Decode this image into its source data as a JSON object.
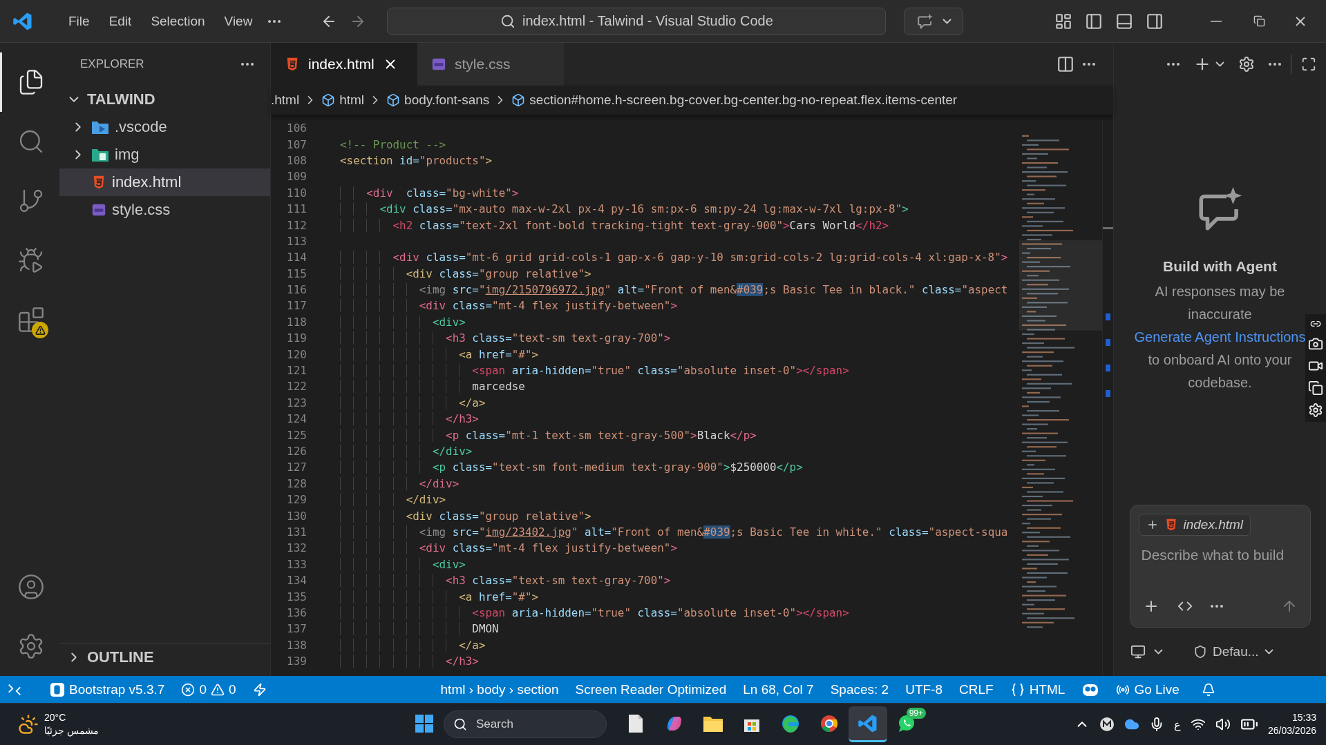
{
  "title_bar": {
    "menu": [
      "File",
      "Edit",
      "Selection",
      "View"
    ],
    "command_center": "index.html - Talwind - Visual Studio Code"
  },
  "activity_bar": [
    {
      "kind": "explorer",
      "selected": true
    },
    {
      "kind": "search",
      "selected": false
    },
    {
      "kind": "source-control",
      "selected": false
    },
    {
      "kind": "run",
      "selected": false
    },
    {
      "kind": "extensions",
      "selected": false,
      "warning": true
    },
    {
      "kind": "account",
      "selected": false
    },
    {
      "kind": "settings",
      "selected": false
    }
  ],
  "explorer": {
    "title": "EXPLORER",
    "root": {
      "label": "TALWIND",
      "expanded": true,
      "children": [
        {
          "label": ".vscode",
          "kind": "folder",
          "expanded": false,
          "selected": false
        },
        {
          "label": "img",
          "kind": "image-folder",
          "expanded": false,
          "selected": false
        },
        {
          "label": "index.html",
          "kind": "html",
          "selected": true
        },
        {
          "label": "style.css",
          "kind": "css",
          "selected": false
        }
      ]
    },
    "outline": {
      "label": "OUTLINE",
      "expanded": false
    }
  },
  "tabs": [
    {
      "label": "index.html",
      "kind": "html",
      "selected": true
    },
    {
      "label": "style.css",
      "kind": "css",
      "selected": false
    }
  ],
  "breadcrumbs": [
    {
      "text": ".html",
      "kind": "file"
    },
    {
      "text": "html",
      "kind": "element"
    },
    {
      "text": "body.font-sans",
      "kind": "element"
    },
    {
      "text": "section#home.h-screen.bg-cover.bg-center.bg-no-repeat.flex.items-center",
      "kind": "element"
    }
  ],
  "editor": {
    "lines": [
      {
        "number": "106"
      },
      {
        "number": "107",
        "tokens": [
          {
            "kind": "comment",
            "text": "<!-- Product -->"
          }
        ]
      },
      {
        "number": "108",
        "tokens": [
          {
            "kind": "tag",
            "text": "<section",
            "color": "#d7ba7d"
          },
          {
            "kind": "attr",
            "text": " id="
          },
          {
            "kind": "string",
            "text": "\"products\""
          },
          {
            "kind": "tag",
            "text": ">",
            "color": "#d7ba7d"
          }
        ]
      },
      {
        "number": "109"
      },
      {
        "number": "110",
        "tokens": [
          {
            "kind": "tag",
            "text": "    <div",
            "color": "#e06c8a"
          },
          {
            "kind": "attr",
            "text": "  class="
          },
          {
            "kind": "string",
            "text": "\"bg-white\""
          },
          {
            "kind": "tag",
            "text": ">",
            "color": "#e06c8a"
          }
        ]
      },
      {
        "number": "111",
        "tokens": [
          {
            "kind": "tag",
            "text": "      <div",
            "color": "#4ec9a0"
          },
          {
            "kind": "attr",
            "text": " class="
          },
          {
            "kind": "string",
            "text": "\"mx-auto max-w-2xl px-4 py-16 sm:px-6 sm:py-24 lg:max-w-7xl lg:px-8\""
          },
          {
            "kind": "tag",
            "text": ">",
            "color": "#4ec9a0"
          }
        ]
      },
      {
        "number": "112",
        "tokens": [
          {
            "kind": "tag",
            "text": "        <h2",
            "color": "#d64a6b"
          },
          {
            "kind": "attr",
            "text": " class="
          },
          {
            "kind": "string",
            "text": "\"text-2xl font-bold tracking-tight text-gray-900\""
          },
          {
            "kind": "tag",
            "text": ">",
            "color": "#d64a6b"
          },
          {
            "kind": "text",
            "text": "Cars World"
          },
          {
            "kind": "tag",
            "text": "</h2>",
            "color": "#d64a6b"
          }
        ]
      },
      {
        "number": "113"
      },
      {
        "number": "114",
        "tokens": [
          {
            "kind": "tag",
            "text": "        <div",
            "color": "#e06c8a"
          },
          {
            "kind": "attr",
            "text": " class="
          },
          {
            "kind": "string",
            "text": "\"mt-6 grid grid-cols-1 gap-x-6 gap-y-10 sm:grid-cols-2 lg:grid-cols-4 xl:gap-x-8\""
          },
          {
            "kind": "tag",
            "text": ">",
            "color": "#e06c8a"
          }
        ]
      },
      {
        "number": "115",
        "tokens": [
          {
            "kind": "tag",
            "text": "          <div",
            "color": "#d7ba7d"
          },
          {
            "kind": "attr",
            "text": " class="
          },
          {
            "kind": "string",
            "text": "\"group relative\""
          },
          {
            "kind": "tag",
            "text": ">",
            "color": "#d7ba7d"
          }
        ]
      },
      {
        "number": "116",
        "tokens": [
          {
            "kind": "tag",
            "text": "            <img",
            "color": "#8c8c8c"
          },
          {
            "kind": "attr",
            "text": " src="
          },
          {
            "kind": "string",
            "text": "\""
          },
          {
            "kind": "link",
            "text": "img/2150796972.jpg"
          },
          {
            "kind": "string",
            "text": "\""
          },
          {
            "kind": "attr",
            "text": " alt="
          },
          {
            "kind": "string",
            "text": "\"Front of men&"
          },
          {
            "kind": "highlight",
            "text": "#039"
          },
          {
            "kind": "string",
            "text": ";s Basic Tee in black.\""
          },
          {
            "kind": "attr",
            "text": " class="
          },
          {
            "kind": "string",
            "text": "\"aspect"
          }
        ]
      },
      {
        "number": "117",
        "tokens": [
          {
            "kind": "tag",
            "text": "            <div",
            "color": "#e06c8a"
          },
          {
            "kind": "attr",
            "text": " class="
          },
          {
            "kind": "string",
            "text": "\"mt-4 flex justify-between\""
          },
          {
            "kind": "tag",
            "text": ">",
            "color": "#e06c8a"
          }
        ]
      },
      {
        "number": "118",
        "tokens": [
          {
            "kind": "tag",
            "text": "              <div>",
            "color": "#4ec9a0"
          }
        ]
      },
      {
        "number": "119",
        "tokens": [
          {
            "kind": "tag",
            "text": "                <h3",
            "color": "#e06c8a"
          },
          {
            "kind": "attr",
            "text": " class="
          },
          {
            "kind": "string",
            "text": "\"text-sm text-gray-700\""
          },
          {
            "kind": "tag",
            "text": ">",
            "color": "#e06c8a"
          }
        ]
      },
      {
        "number": "120",
        "tokens": [
          {
            "kind": "tag",
            "text": "                  <a",
            "color": "#d7ba7d"
          },
          {
            "kind": "attr",
            "text": " href="
          },
          {
            "kind": "string",
            "text": "\"#\""
          },
          {
            "kind": "tag",
            "text": ">",
            "color": "#d7ba7d"
          }
        ]
      },
      {
        "number": "121",
        "tokens": [
          {
            "kind": "tag",
            "text": "                    <span",
            "color": "#d64a6b"
          },
          {
            "kind": "attr",
            "text": " aria-hidden="
          },
          {
            "kind": "string",
            "text": "\"true\""
          },
          {
            "kind": "attr",
            "text": " class="
          },
          {
            "kind": "string",
            "text": "\"absolute inset-0\""
          },
          {
            "kind": "tag",
            "text": "></span>",
            "color": "#d64a6b"
          }
        ]
      },
      {
        "number": "122",
        "tokens": [
          {
            "kind": "text",
            "text": "                    marcedse"
          }
        ]
      },
      {
        "number": "123",
        "tokens": [
          {
            "kind": "tag",
            "text": "                  </a>",
            "color": "#d7ba7d"
          }
        ]
      },
      {
        "number": "124",
        "tokens": [
          {
            "kind": "tag",
            "text": "                </h3>",
            "color": "#e06c8a"
          }
        ]
      },
      {
        "number": "125",
        "tokens": [
          {
            "kind": "tag",
            "text": "                <p",
            "color": "#e06c8a"
          },
          {
            "kind": "attr",
            "text": " class="
          },
          {
            "kind": "string",
            "text": "\"mt-1 text-sm text-gray-500\""
          },
          {
            "kind": "tag",
            "text": ">",
            "color": "#e06c8a"
          },
          {
            "kind": "text",
            "text": "Black"
          },
          {
            "kind": "tag",
            "text": "</p>",
            "color": "#e06c8a"
          }
        ]
      },
      {
        "number": "126",
        "tokens": [
          {
            "kind": "tag",
            "text": "              </div>",
            "color": "#4ec9a0"
          }
        ]
      },
      {
        "number": "127",
        "tokens": [
          {
            "kind": "tag",
            "text": "              <p",
            "color": "#4ec9a0"
          },
          {
            "kind": "attr",
            "text": " class="
          },
          {
            "kind": "string",
            "text": "\"text-sm font-medium text-gray-900\""
          },
          {
            "kind": "tag",
            "text": ">",
            "color": "#4ec9a0"
          },
          {
            "kind": "text",
            "text": "$250000"
          },
          {
            "kind": "tag",
            "text": "</p>",
            "color": "#4ec9a0"
          }
        ]
      },
      {
        "number": "128",
        "tokens": [
          {
            "kind": "tag",
            "text": "            </div>",
            "color": "#e06c8a"
          }
        ]
      },
      {
        "number": "129",
        "tokens": [
          {
            "kind": "tag",
            "text": "          </div>",
            "color": "#d7ba7d"
          }
        ]
      },
      {
        "number": "130",
        "tokens": [
          {
            "kind": "tag",
            "text": "          <div",
            "color": "#d7ba7d"
          },
          {
            "kind": "attr",
            "text": " class="
          },
          {
            "kind": "string",
            "text": "\"group relative\""
          },
          {
            "kind": "tag",
            "text": ">",
            "color": "#d7ba7d"
          }
        ]
      },
      {
        "number": "131",
        "tokens": [
          {
            "kind": "tag",
            "text": "            <img",
            "color": "#8c8c8c"
          },
          {
            "kind": "attr",
            "text": " src="
          },
          {
            "kind": "string",
            "text": "\""
          },
          {
            "kind": "link",
            "text": "img/23402.jpg"
          },
          {
            "kind": "string",
            "text": "\""
          },
          {
            "kind": "attr",
            "text": " alt="
          },
          {
            "kind": "string",
            "text": "\"Front of men&"
          },
          {
            "kind": "highlight",
            "text": "#039"
          },
          {
            "kind": "string",
            "text": ";s Basic Tee in white.\""
          },
          {
            "kind": "attr",
            "text": " class="
          },
          {
            "kind": "string",
            "text": "\"aspect-squa"
          }
        ]
      },
      {
        "number": "132",
        "tokens": [
          {
            "kind": "tag",
            "text": "            <div",
            "color": "#e06c8a"
          },
          {
            "kind": "attr",
            "text": " class="
          },
          {
            "kind": "string",
            "text": "\"mt-4 flex justify-between\""
          },
          {
            "kind": "tag",
            "text": ">",
            "color": "#e06c8a"
          }
        ]
      },
      {
        "number": "133",
        "tokens": [
          {
            "kind": "tag",
            "text": "              <div>",
            "color": "#4ec9a0"
          }
        ]
      },
      {
        "number": "134",
        "tokens": [
          {
            "kind": "tag",
            "text": "                <h3",
            "color": "#e06c8a"
          },
          {
            "kind": "attr",
            "text": " class="
          },
          {
            "kind": "string",
            "text": "\"text-sm text-gray-700\""
          },
          {
            "kind": "tag",
            "text": ">",
            "color": "#e06c8a"
          }
        ]
      },
      {
        "number": "135",
        "tokens": [
          {
            "kind": "tag",
            "text": "                  <a",
            "color": "#d7ba7d"
          },
          {
            "kind": "attr",
            "text": " href="
          },
          {
            "kind": "string",
            "text": "\"#\""
          },
          {
            "kind": "tag",
            "text": ">",
            "color": "#d7ba7d"
          }
        ]
      },
      {
        "number": "136",
        "tokens": [
          {
            "kind": "tag",
            "text": "                    <span",
            "color": "#d64a6b"
          },
          {
            "kind": "attr",
            "text": " aria-hidden="
          },
          {
            "kind": "string",
            "text": "\"true\""
          },
          {
            "kind": "attr",
            "text": " class="
          },
          {
            "kind": "string",
            "text": "\"absolute inset-0\""
          },
          {
            "kind": "tag",
            "text": "></span>",
            "color": "#d64a6b"
          }
        ]
      },
      {
        "number": "137",
        "tokens": [
          {
            "kind": "text",
            "text": "                    DMON"
          }
        ]
      },
      {
        "number": "138",
        "tokens": [
          {
            "kind": "tag",
            "text": "                  </a>",
            "color": "#d7ba7d"
          }
        ]
      },
      {
        "number": "139",
        "tokens": [
          {
            "kind": "tag",
            "text": "                </h3>",
            "color": "#e06c8a"
          }
        ]
      }
    ]
  },
  "agent": {
    "title": "Build with Agent",
    "intro": "AI responses may be inaccurate",
    "link": "Generate Agent Instructions",
    "outro": "to onboard AI onto your codebase.",
    "context_file": "index.html",
    "placeholder": "Describe what to build",
    "mode": "Defau..."
  },
  "status_bar": [
    {
      "kind": "remote"
    },
    {
      "kind": "bootstrap",
      "text": "Bootstrap v5.3.7"
    },
    {
      "kind": "problems",
      "errors": "0",
      "warnings": "0"
    },
    {
      "kind": "lightning"
    },
    {
      "kind": "text",
      "text": "html › body › section"
    },
    {
      "kind": "text",
      "text": "Screen Reader Optimized"
    },
    {
      "kind": "text",
      "text": "Ln 68, Col 7"
    },
    {
      "kind": "text",
      "text": "Spaces: 2"
    },
    {
      "kind": "text",
      "text": "UTF-8"
    },
    {
      "kind": "text",
      "text": "CRLF"
    },
    {
      "kind": "language",
      "text": "HTML"
    },
    {
      "kind": "copilot"
    },
    {
      "kind": "golive",
      "text": "Go Live"
    },
    {
      "kind": "bell"
    }
  ],
  "taskbar": {
    "weather": {
      "temperature": "20°C",
      "condition": "مشمس جزئيًا"
    },
    "search": {
      "placeholder": "Search"
    },
    "apps": [
      {
        "kind": "start",
        "selected": false
      },
      {
        "kind": "files",
        "selected": false
      },
      {
        "kind": "copilot",
        "selected": false
      },
      {
        "kind": "folder",
        "selected": false
      },
      {
        "kind": "store",
        "selected": false
      },
      {
        "kind": "edge",
        "selected": false
      },
      {
        "kind": "chrome",
        "selected": false
      },
      {
        "kind": "vscode",
        "selected": true
      },
      {
        "kind": "whatsapp",
        "selected": false,
        "badge": "99+"
      }
    ],
    "tray": {
      "language": "ع",
      "time": "15:33",
      "date": "26/03/2026"
    }
  }
}
